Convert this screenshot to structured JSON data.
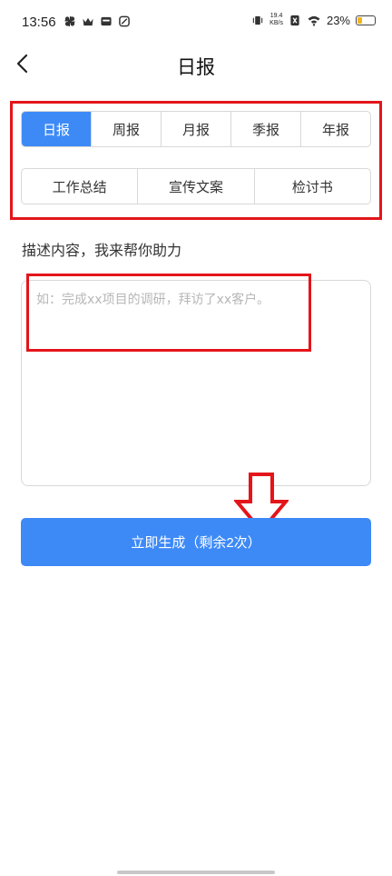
{
  "status_bar": {
    "time": "13:56",
    "net_speed_value": "19.4",
    "net_speed_unit": "KB/s",
    "battery_percent": "23%",
    "battery_level": 0.23,
    "battery_color": "#f3b51d",
    "icons_left": [
      "pinwheel-icon",
      "crown-icon",
      "inbox-icon",
      "link-icon"
    ],
    "icons_right": [
      "vibrate-icon",
      "net-speed",
      "sim-off-icon",
      "wifi-icon",
      "battery-icon"
    ]
  },
  "header": {
    "back_icon": "chevron-left-icon",
    "title": "日报"
  },
  "tabs": {
    "row1": [
      "日报",
      "周报",
      "月报",
      "季报",
      "年报"
    ],
    "row2": [
      "工作总结",
      "宣传文案",
      "检讨书"
    ],
    "active": "日报"
  },
  "form": {
    "label": "描述内容，我来帮你助力",
    "placeholder": "如：完成xx项目的调研，拜访了xx客户。",
    "value": ""
  },
  "generate_button": {
    "label": "立即生成（剩余2次）"
  },
  "colors": {
    "accent": "#3d8af7",
    "annotation_red": "#e3151a"
  }
}
